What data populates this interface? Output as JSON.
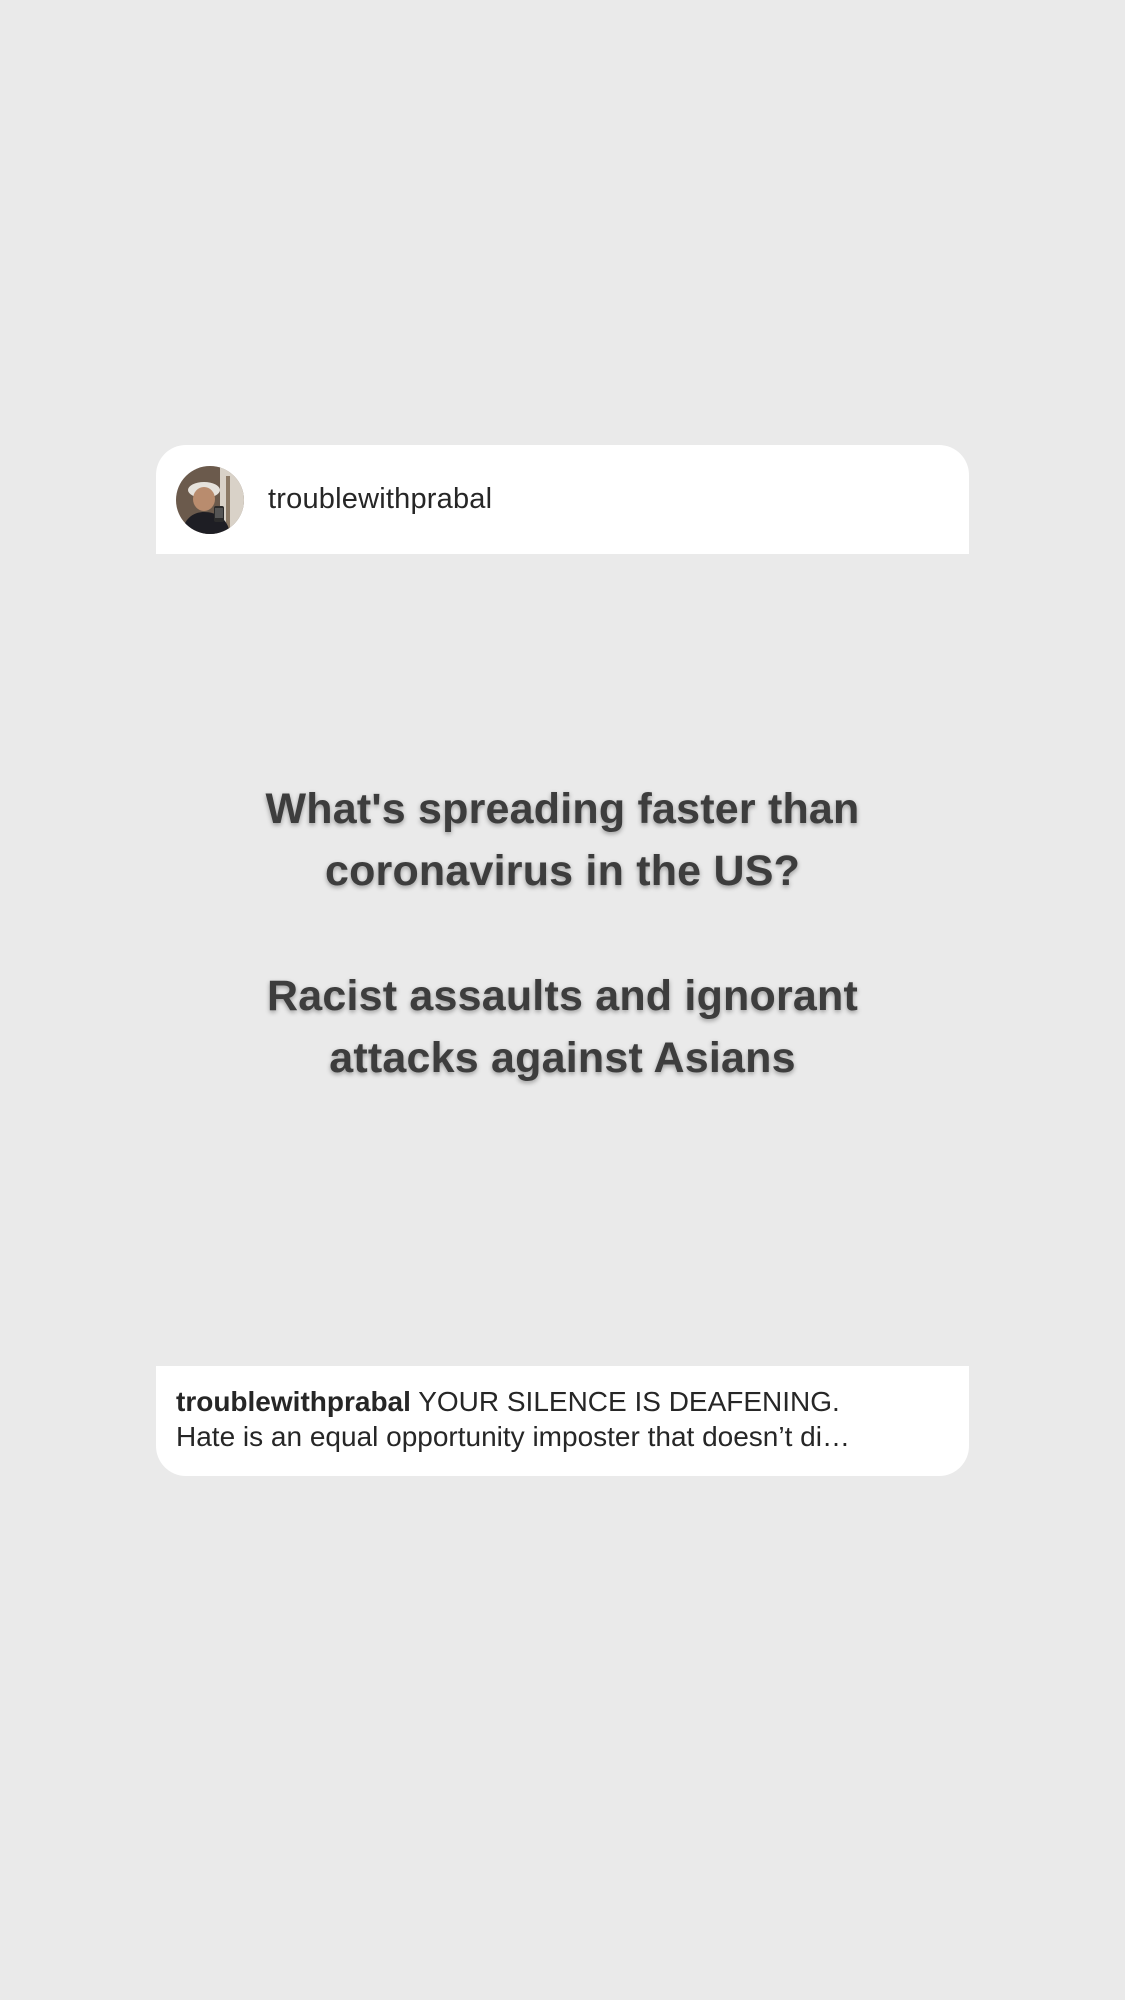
{
  "post": {
    "header": {
      "username": "troublewithprabal",
      "avatar_icon": "profile-photo"
    },
    "image_text": {
      "question_lines": [
        "What's spreading faster than",
        "coronavirus in the US?"
      ],
      "answer_lines": [
        "Racist assaults and ignorant",
        "attacks against Asians"
      ]
    },
    "caption": {
      "username": "troublewithprabal",
      "text_line1": "YOUR SILENCE IS DEAFENING.",
      "text_line2": "Hate is an equal opportunity imposter that doesn’t di…"
    }
  },
  "colors": {
    "background": "#eaeaea",
    "card": "#ffffff",
    "text": "#262626",
    "image_text": "#3d3d3d"
  }
}
